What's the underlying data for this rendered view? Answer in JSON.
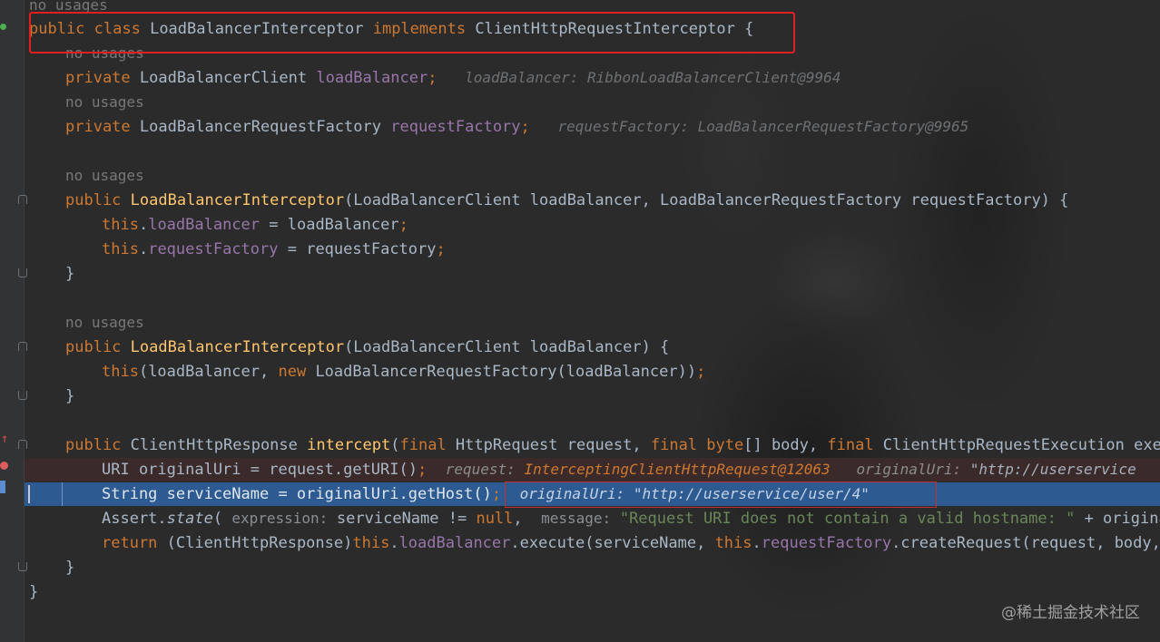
{
  "code": {
    "usage_top": "no usages",
    "class_decl": {
      "public": "public ",
      "class": "class ",
      "name": "LoadBalancerInterceptor ",
      "implements": "implements ",
      "iface": "ClientHttpRequestInterceptor {"
    },
    "field1_usage": "no usages",
    "field1": {
      "private": "private ",
      "type": "LoadBalancerClient ",
      "name": "loadBalancer",
      "semi": ";",
      "debug_key": "loadBalancer: ",
      "debug_val": "RibbonLoadBalancerClient@9964"
    },
    "field2_usage": "no usages",
    "field2": {
      "private": "private ",
      "type": "LoadBalancerRequestFactory ",
      "name": "requestFactory",
      "semi": ";",
      "debug_key": "requestFactory: ",
      "debug_val": "LoadBalancerRequestFactory@9965"
    },
    "ctor1_usage": "no usages",
    "ctor1": {
      "public": "public ",
      "name": "LoadBalancerInterceptor",
      "params": "(LoadBalancerClient loadBalancer, LoadBalancerRequestFactory requestFactory) {"
    },
    "ctor1_line1": {
      "this": "this",
      "dot": ".",
      "field": "loadBalancer",
      "rest": " = loadBalancer",
      "semi": ";"
    },
    "ctor1_line2": {
      "this": "this",
      "dot": ".",
      "field": "requestFactory",
      "rest": " = requestFactory",
      "semi": ";"
    },
    "close_brace": "}",
    "ctor2_usage": "no usages",
    "ctor2": {
      "public": "public ",
      "name": "LoadBalancerInterceptor",
      "params": "(LoadBalancerClient loadBalancer) {"
    },
    "ctor2_line1": {
      "this": "this",
      "a": "(loadBalancer, ",
      "new": "new ",
      "b": "LoadBalancerRequestFactory(loadBalancer))",
      "semi": ";"
    },
    "intercept_sig": {
      "public": "public ",
      "type": "ClientHttpResponse ",
      "name": "intercept",
      "p1": "(",
      "final1": "final ",
      "a": "HttpRequest request, ",
      "final2": "final ",
      "byte": "byte",
      "b": "[] body, ",
      "final3": "final ",
      "c": "ClientHttpRequestExecution execut"
    },
    "line_uri": {
      "code": "URI originalUri = request.getURI()",
      "semi": ";",
      "dbg1_key": "request: ",
      "dbg1_val": "InterceptingClientHttpRequest@12063",
      "dbg2_key": "originalUri: ",
      "dbg2_val": "\"http://userservice"
    },
    "line_service": {
      "code": "String serviceName = originalUri.getHost()",
      "semi": ";",
      "dbg_key": "originalUri: ",
      "dbg_val": "\"http://userservice/user/4\""
    },
    "line_assert": {
      "a": "Assert.",
      "state": "state",
      "b": "( ",
      "hint1": "expression: ",
      "c": "serviceName != ",
      "null": "null",
      "d": ",  ",
      "hint2": "message: ",
      "str": "\"Request URI does not contain a valid hostname: \"",
      "e": " + originalU"
    },
    "line_return": {
      "return": "return ",
      "a": "(ClientHttpResponse)",
      "this1": "this",
      "dot1": ".",
      "f1": "loadBalancer",
      "b": ".execute(serviceName, ",
      "this2": "this",
      "dot2": ".",
      "f2": "requestFactory",
      "c": ".createRequest(request, body, ex"
    },
    "method_close": "}",
    "class_close": "}"
  },
  "watermark": "@稀土掘金技术社区",
  "colors": {
    "background": "#2b2b2b",
    "keyword": "#cc7832",
    "field": "#9876aa",
    "method": "#ffc66d",
    "string": "#6a8759",
    "execution_line": "#2d5a91",
    "highlight_box": "#e02020"
  }
}
